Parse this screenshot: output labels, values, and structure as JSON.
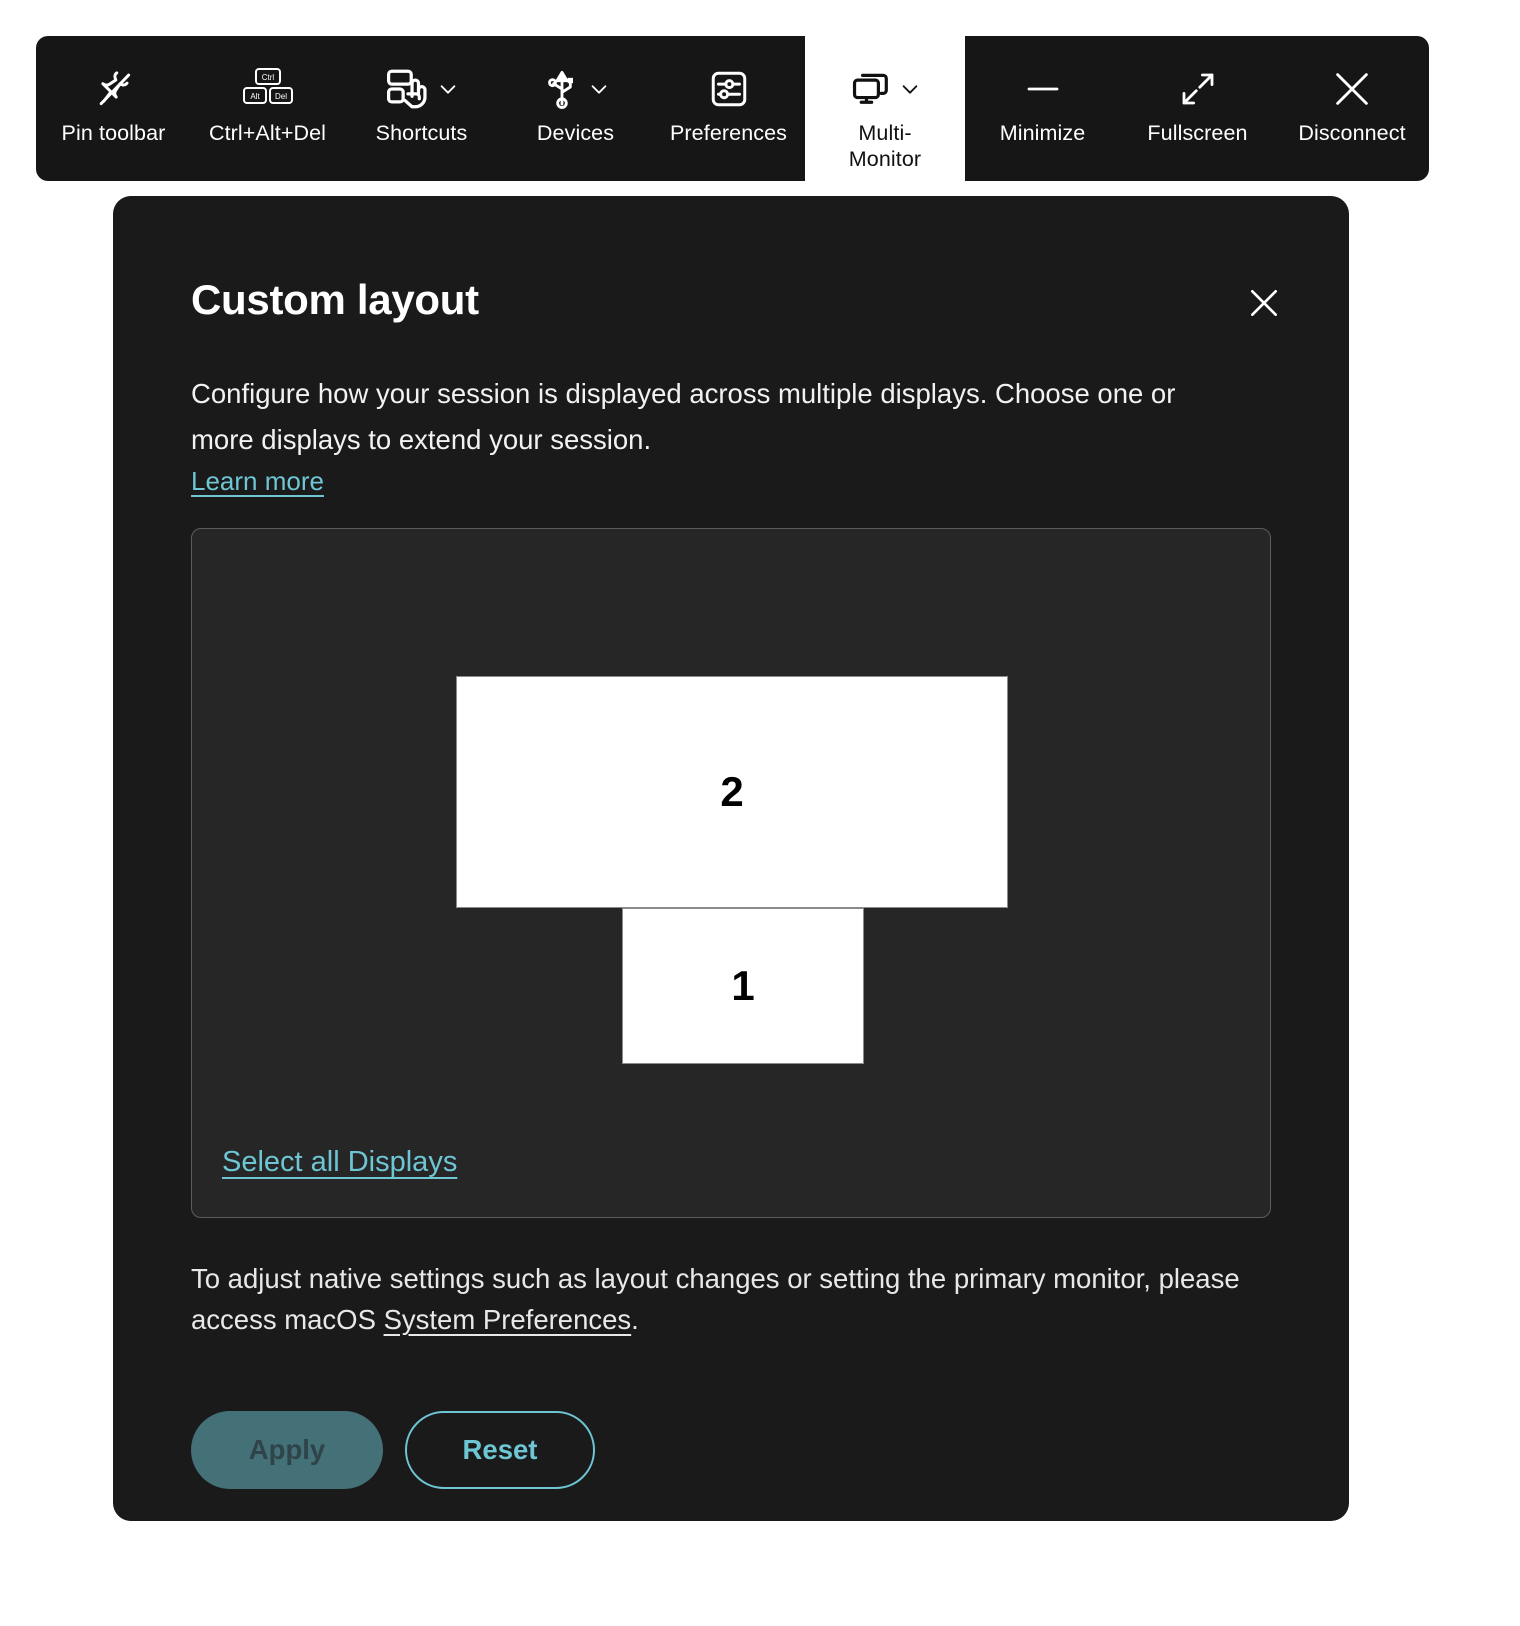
{
  "toolbar": {
    "items": [
      {
        "label": "Pin toolbar",
        "icon": "pin-off-icon",
        "chevron": false,
        "active": false
      },
      {
        "label": "Ctrl+Alt+Del",
        "icon": "ctrl-alt-del-icon",
        "chevron": false,
        "active": false
      },
      {
        "label": "Shortcuts",
        "icon": "keyboard-hand-icon",
        "chevron": true,
        "active": false
      },
      {
        "label": "Devices",
        "icon": "usb-icon",
        "chevron": true,
        "active": false
      },
      {
        "label": "Preferences",
        "icon": "sliders-icon",
        "chevron": false,
        "active": false
      },
      {
        "label": "Multi-\nMonitor",
        "icon": "multi-monitor-icon",
        "chevron": true,
        "active": true
      },
      {
        "label": "Minimize",
        "icon": "minimize-icon",
        "chevron": false,
        "active": false
      },
      {
        "label": "Fullscreen",
        "icon": "fullscreen-icon",
        "chevron": false,
        "active": false
      },
      {
        "label": "Disconnect",
        "icon": "close-x-icon",
        "chevron": false,
        "active": false
      }
    ]
  },
  "dialog": {
    "title": "Custom layout",
    "description": "Configure how your session is displayed across multiple displays. Choose one or more displays to extend your session.",
    "learn_more_label": "Learn more",
    "close_label": "Close",
    "panel": {
      "displays": [
        {
          "number": "2",
          "selected": true
        },
        {
          "number": "1",
          "selected": true
        }
      ],
      "select_all_label": "Select all Displays"
    },
    "footer_note_prefix": "To adjust native settings such as layout changes or setting the primary monitor, please access macOS ",
    "footer_note_link": "System Preferences",
    "footer_note_suffix": ".",
    "buttons": {
      "apply_label": "Apply",
      "reset_label": "Reset"
    }
  },
  "colors": {
    "accent_teal": "#6ec5d3",
    "apply_disabled_bg": "#447078",
    "apply_disabled_text": "#2e4449",
    "toolbar_bg": "#161616",
    "dialog_bg": "#1a1a1a",
    "panel_bg": "#262626"
  }
}
